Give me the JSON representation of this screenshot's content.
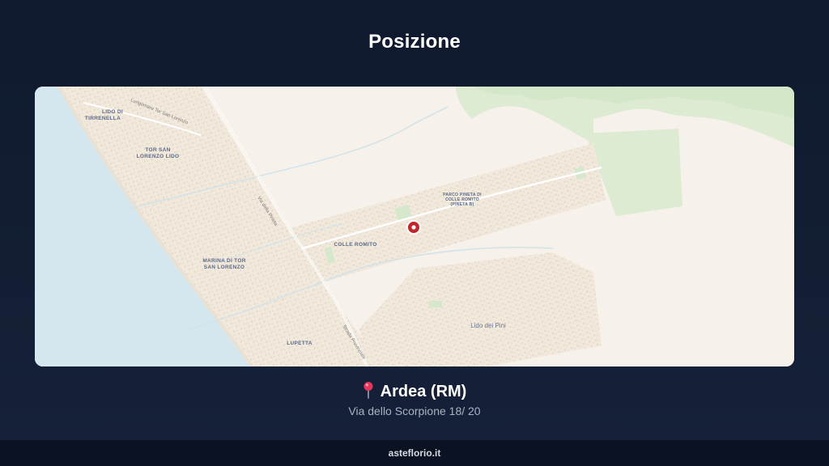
{
  "header": {
    "title": "Posizione"
  },
  "map": {
    "labels": {
      "lido_di_tirrenella_1": "LIDO DI",
      "lido_di_tirrenella_2": "TIRRENELLA",
      "tor_san_lorenzo_lido_1": "TOR SAN",
      "tor_san_lorenzo_lido_2": "LORENZO LIDO",
      "marina_1": "MARINA DI TOR",
      "marina_2": "SAN LORENZO",
      "colle_romito": "COLLE ROMITO",
      "parco_1": "PARCO PINETA DI",
      "parco_2": "COLLE ROMITO",
      "parco_3": "(PINETA B)",
      "lupetta": "LUPETTA",
      "lido_dei_pini": "Lido dei Pini"
    },
    "roads": {
      "lungomare": "Lungomare Tor San Lorenzo",
      "via_pineta": "Via della Pineta",
      "strada_provinciale": "Strada Provinciale"
    },
    "colors": {
      "sea": "#d4e6ee",
      "land": "#f6f1ea",
      "green": "#dcebd2",
      "urban": "#ece3d6",
      "marker": "#c0272d"
    },
    "marker_icon": "location-marker-icon"
  },
  "location": {
    "city": "Ardea (RM)",
    "address": "Via dello Scorpione 18/ 20",
    "pin_icon": "round-pushpin-icon"
  },
  "footer": {
    "site": "asteflorio.it"
  }
}
